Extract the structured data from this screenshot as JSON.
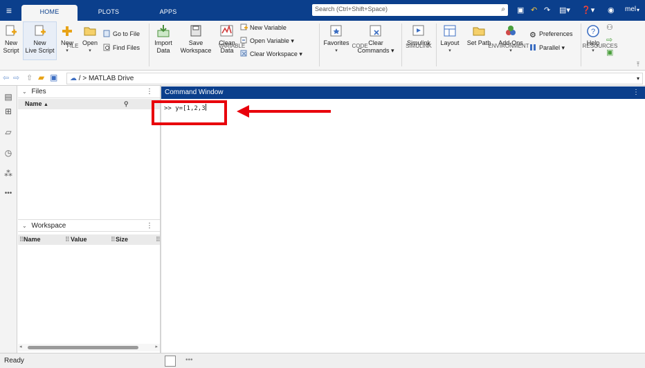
{
  "topbar": {
    "tabs": [
      "HOME",
      "PLOTS",
      "APPS"
    ],
    "search_placeholder": "Search (Ctrl+Shift+Space)",
    "user": "mel"
  },
  "ribbon": {
    "file": {
      "new_script": [
        "New",
        "Script"
      ],
      "new_live_script": [
        "New",
        "Live Script"
      ],
      "new": "New",
      "open": "Open",
      "go_to_file": "Go to File",
      "find_files": "Find Files",
      "group": "FILE"
    },
    "variable": {
      "import_data": [
        "Import",
        "Data"
      ],
      "save_workspace": [
        "Save",
        "Workspace"
      ],
      "clean_data": [
        "Clean",
        "Data"
      ],
      "new_variable": "New Variable",
      "open_variable": "Open Variable",
      "clear_workspace": "Clear Workspace",
      "group": "VARIABLE"
    },
    "code": {
      "favorites": "Favorites",
      "clear_commands": [
        "Clear",
        "Commands"
      ],
      "group": "CODE"
    },
    "simulink": {
      "simulink": "Simulink",
      "group": "SIMULINK"
    },
    "environment": {
      "layout": "Layout",
      "set_path": "Set Path",
      "add_ons": "Add-Ons",
      "preferences": "Preferences",
      "parallel": "Parallel",
      "group": "ENVIRONMENT"
    },
    "resources": {
      "help": "Help",
      "group": "RESOURCES"
    }
  },
  "address": {
    "path_sep": "/ >",
    "location": "MATLAB Drive"
  },
  "files_panel": {
    "title": "Files",
    "col_name": "Name"
  },
  "workspace_panel": {
    "title": "Workspace",
    "col_name": "Name",
    "col_value": "Value",
    "col_size": "Size"
  },
  "command_window": {
    "title": "Command Window",
    "prompt": ">>",
    "input": "y=[1,2,3"
  },
  "status": {
    "text": "Ready"
  },
  "colors": {
    "brand": "#0b3f8c",
    "highlight": "#e8000b"
  }
}
